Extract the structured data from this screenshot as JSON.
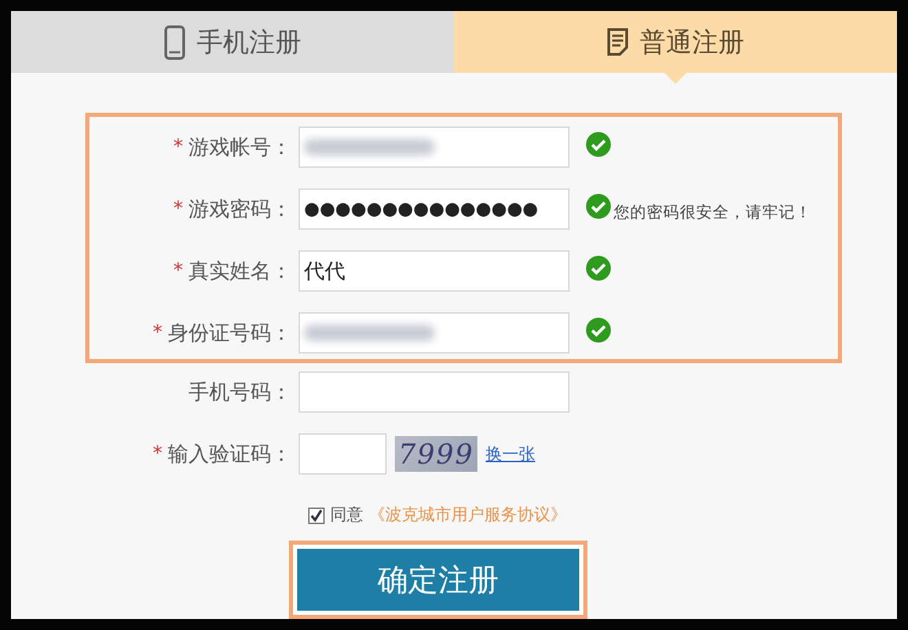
{
  "tabs": [
    {
      "label": "手机注册",
      "kind": "phone",
      "selected": false
    },
    {
      "label": "普通注册",
      "kind": "document",
      "selected": true
    }
  ],
  "sections": [
    {
      "highlighted": true,
      "rows": [
        {
          "label": "游戏帐号：",
          "required_mark": "*",
          "kind": "blurred",
          "valid": true
        },
        {
          "label": "游戏密码：",
          "required_mark": "*",
          "kind": "password",
          "value": "●●●●●●●●●●●●●●●",
          "valid": true,
          "hint": "您的密码很安全，请牢记！"
        },
        {
          "label": "真实姓名：",
          "required_mark": "*",
          "kind": "text",
          "value": "代代",
          "valid": true
        },
        {
          "label": "身份证号码：",
          "required_mark": "*",
          "kind": "blurred",
          "valid": true
        }
      ]
    },
    {
      "highlighted": false,
      "rows": [
        {
          "label": "手机号码：",
          "kind": "empty",
          "valid": false
        },
        {
          "label": "输入验证码：",
          "required_mark": "*",
          "kind": "captcha",
          "captcha": "7999",
          "refresh": "换一张",
          "valid": false
        }
      ]
    }
  ],
  "agreement": {
    "checked": true,
    "label": "同意",
    "link": "《波克城市用户服务协议》"
  },
  "submit": {
    "label": "确定注册",
    "highlighted": true
  }
}
